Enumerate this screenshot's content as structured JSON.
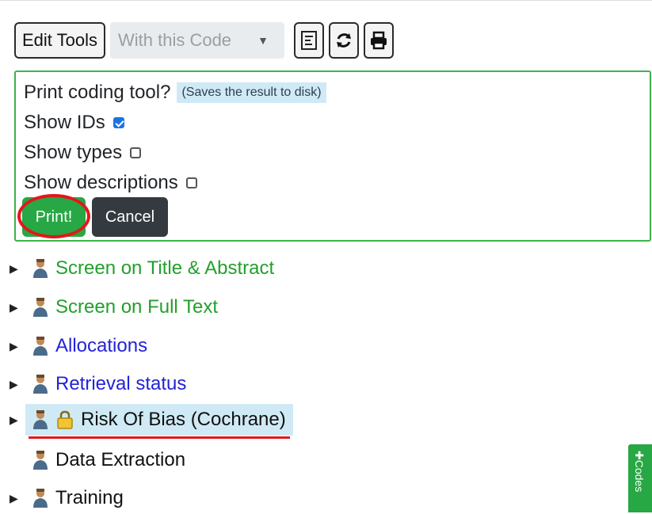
{
  "toolbar": {
    "edit_tools_label": "Edit Tools",
    "with_code_select": "With this Code",
    "icons": [
      "list-icon",
      "refresh-icon",
      "print-icon"
    ]
  },
  "print_panel": {
    "question": "Print coding tool?",
    "hint": "(Saves the result to disk)",
    "options": [
      {
        "label": "Show IDs",
        "checked": true
      },
      {
        "label": "Show types",
        "checked": false
      },
      {
        "label": "Show descriptions",
        "checked": false
      }
    ],
    "print_label": "Print!",
    "cancel_label": "Cancel"
  },
  "tree": [
    {
      "label": "Screen on Title & Abstract",
      "color": "#22a02c",
      "expandable": true
    },
    {
      "label": "Screen on Full Text",
      "color": "#22a02c",
      "expandable": true
    },
    {
      "label": "Allocations",
      "color": "#2323d6",
      "expandable": true
    },
    {
      "label": "Retrieval status",
      "color": "#2323d6",
      "expandable": true
    },
    {
      "label": "Risk Of Bias (Cochrane)",
      "color": "#111111",
      "expandable": true,
      "locked": true,
      "selected": true
    },
    {
      "label": "Data Extraction",
      "color": "#111111",
      "expandable": false
    },
    {
      "label": "Training",
      "color": "#111111",
      "expandable": true
    }
  ],
  "side_tab_label": "✚Codes"
}
